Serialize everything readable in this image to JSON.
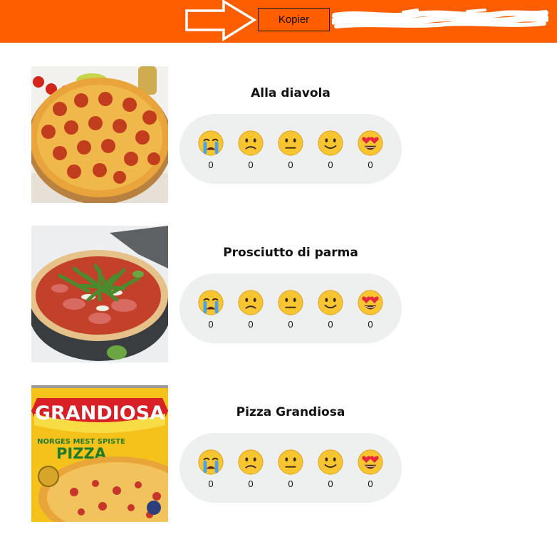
{
  "header": {
    "copy_button_label": "Kopier",
    "background_color": "#ff5e00",
    "arrow_icon": "right-arrow-outline-icon",
    "redacted_text": "redacted-link-scribble"
  },
  "reaction_icons": [
    "crying-face-icon",
    "confused-face-icon",
    "neutral-face-icon",
    "smiling-face-icon",
    "heart-eyes-face-icon"
  ],
  "pizzas": [
    {
      "name": "Alla diavola",
      "image": "pepperoni-pizza-photo",
      "reactions": [
        {
          "icon": "crying-face-icon",
          "count": "0"
        },
        {
          "icon": "confused-face-icon",
          "count": "0"
        },
        {
          "icon": "neutral-face-icon",
          "count": "0"
        },
        {
          "icon": "smiling-face-icon",
          "count": "0"
        },
        {
          "icon": "heart-eyes-face-icon",
          "count": "0"
        }
      ]
    },
    {
      "name": "Prosciutto di parma",
      "image": "prosciutto-rucola-pizza-photo",
      "reactions": [
        {
          "icon": "crying-face-icon",
          "count": "0"
        },
        {
          "icon": "confused-face-icon",
          "count": "0"
        },
        {
          "icon": "neutral-face-icon",
          "count": "0"
        },
        {
          "icon": "smiling-face-icon",
          "count": "0"
        },
        {
          "icon": "heart-eyes-face-icon",
          "count": "0"
        }
      ]
    },
    {
      "name": "Pizza Grandiosa",
      "image": "grandiosa-package-photo",
      "package_text": {
        "brand": "GRANDIOSA",
        "tagline": "NORGES MEST SPISTE",
        "product": "PIZZA"
      },
      "reactions": [
        {
          "icon": "crying-face-icon",
          "count": "0"
        },
        {
          "icon": "confused-face-icon",
          "count": "0"
        },
        {
          "icon": "neutral-face-icon",
          "count": "0"
        },
        {
          "icon": "smiling-face-icon",
          "count": "0"
        },
        {
          "icon": "heart-eyes-face-icon",
          "count": "0"
        }
      ]
    }
  ]
}
